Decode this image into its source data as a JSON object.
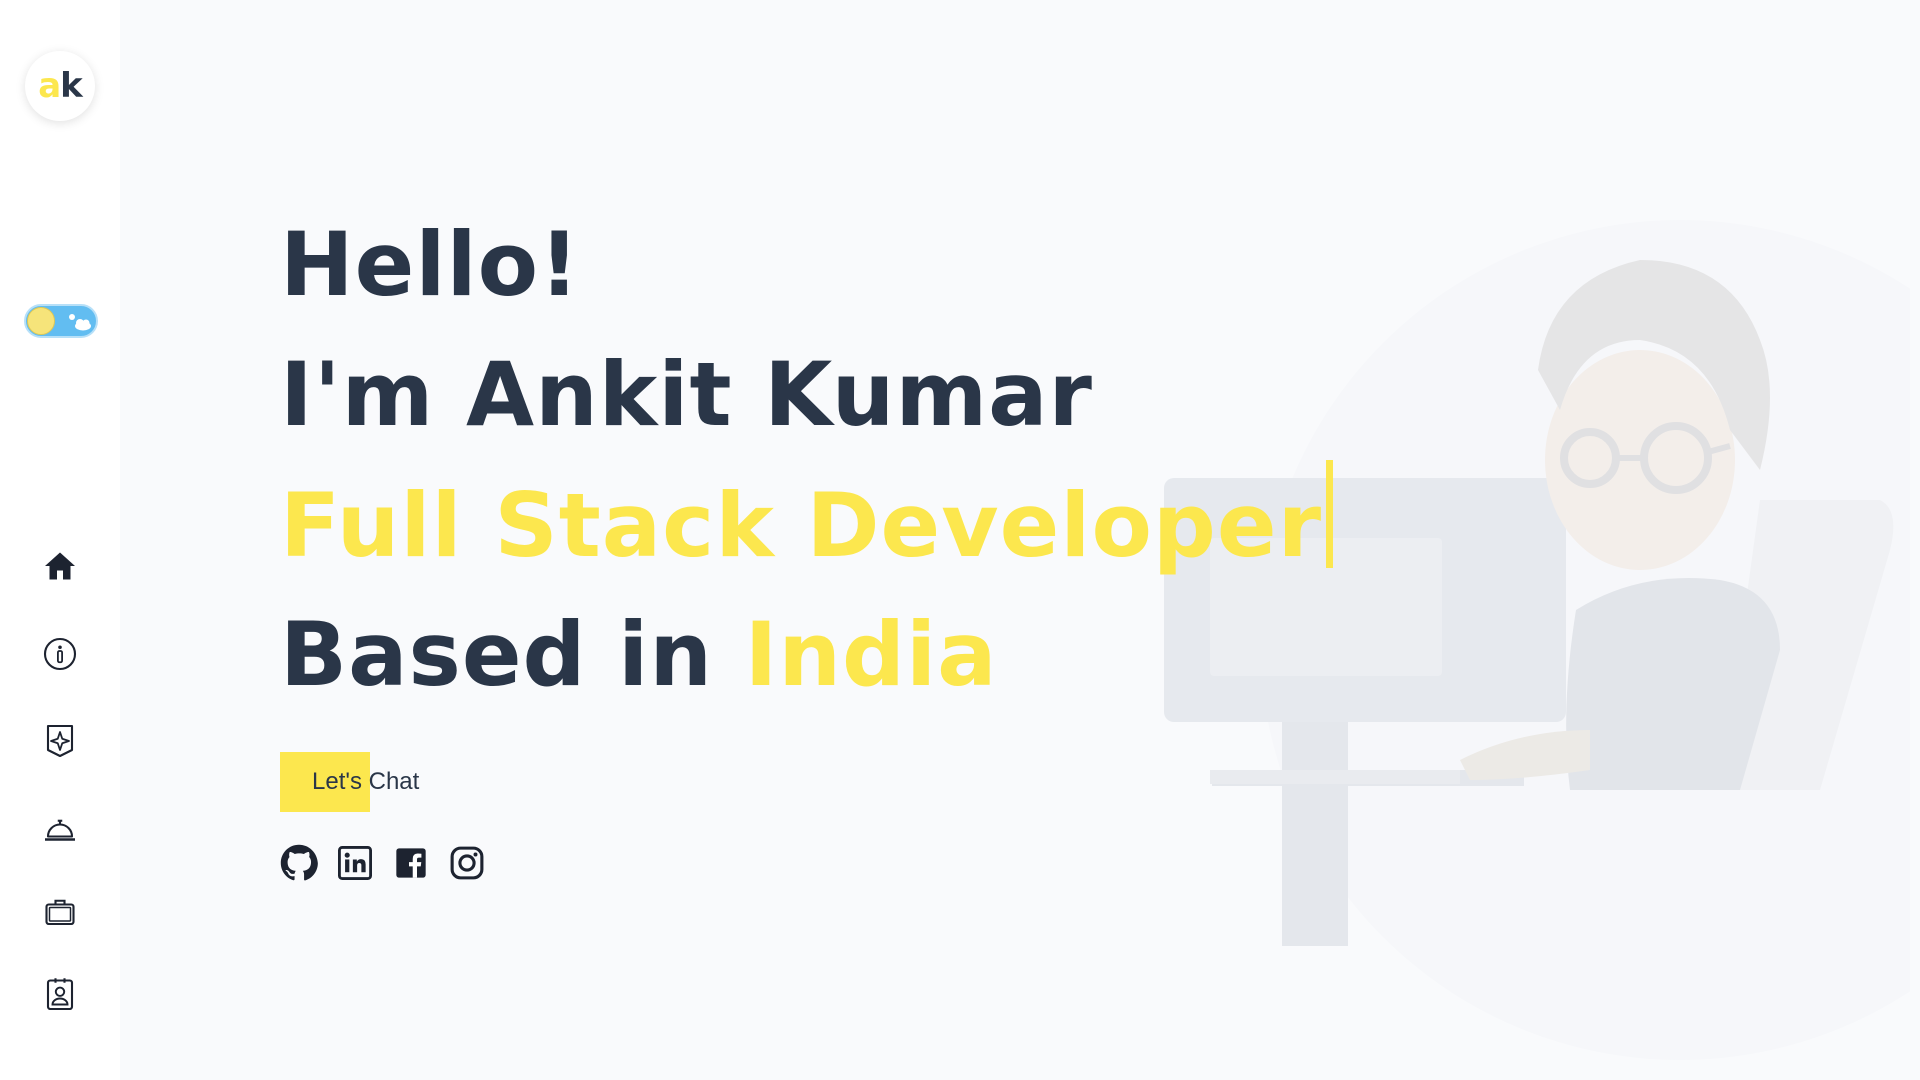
{
  "logo": {
    "part_a": "a",
    "part_k": "k"
  },
  "theme_toggle": {
    "state": "light"
  },
  "nav": [
    {
      "icon": "home-icon"
    },
    {
      "icon": "info-icon"
    },
    {
      "icon": "sparkle-icon"
    },
    {
      "icon": "service-bell-icon"
    },
    {
      "icon": "briefcase-icon"
    },
    {
      "icon": "contact-card-icon"
    }
  ],
  "hero": {
    "greeting": "Hello!",
    "intro": "I'm Ankit Kumar",
    "role": "Full Stack Developer",
    "based_prefix": "Based in ",
    "location": "India"
  },
  "cta": {
    "label": "Let's Chat"
  },
  "socials": [
    "github-icon",
    "linkedin-icon",
    "facebook-icon",
    "instagram-icon"
  ],
  "colors": {
    "accent": "#fce74e",
    "text": "#2a3648",
    "background": "#f9fafc"
  }
}
